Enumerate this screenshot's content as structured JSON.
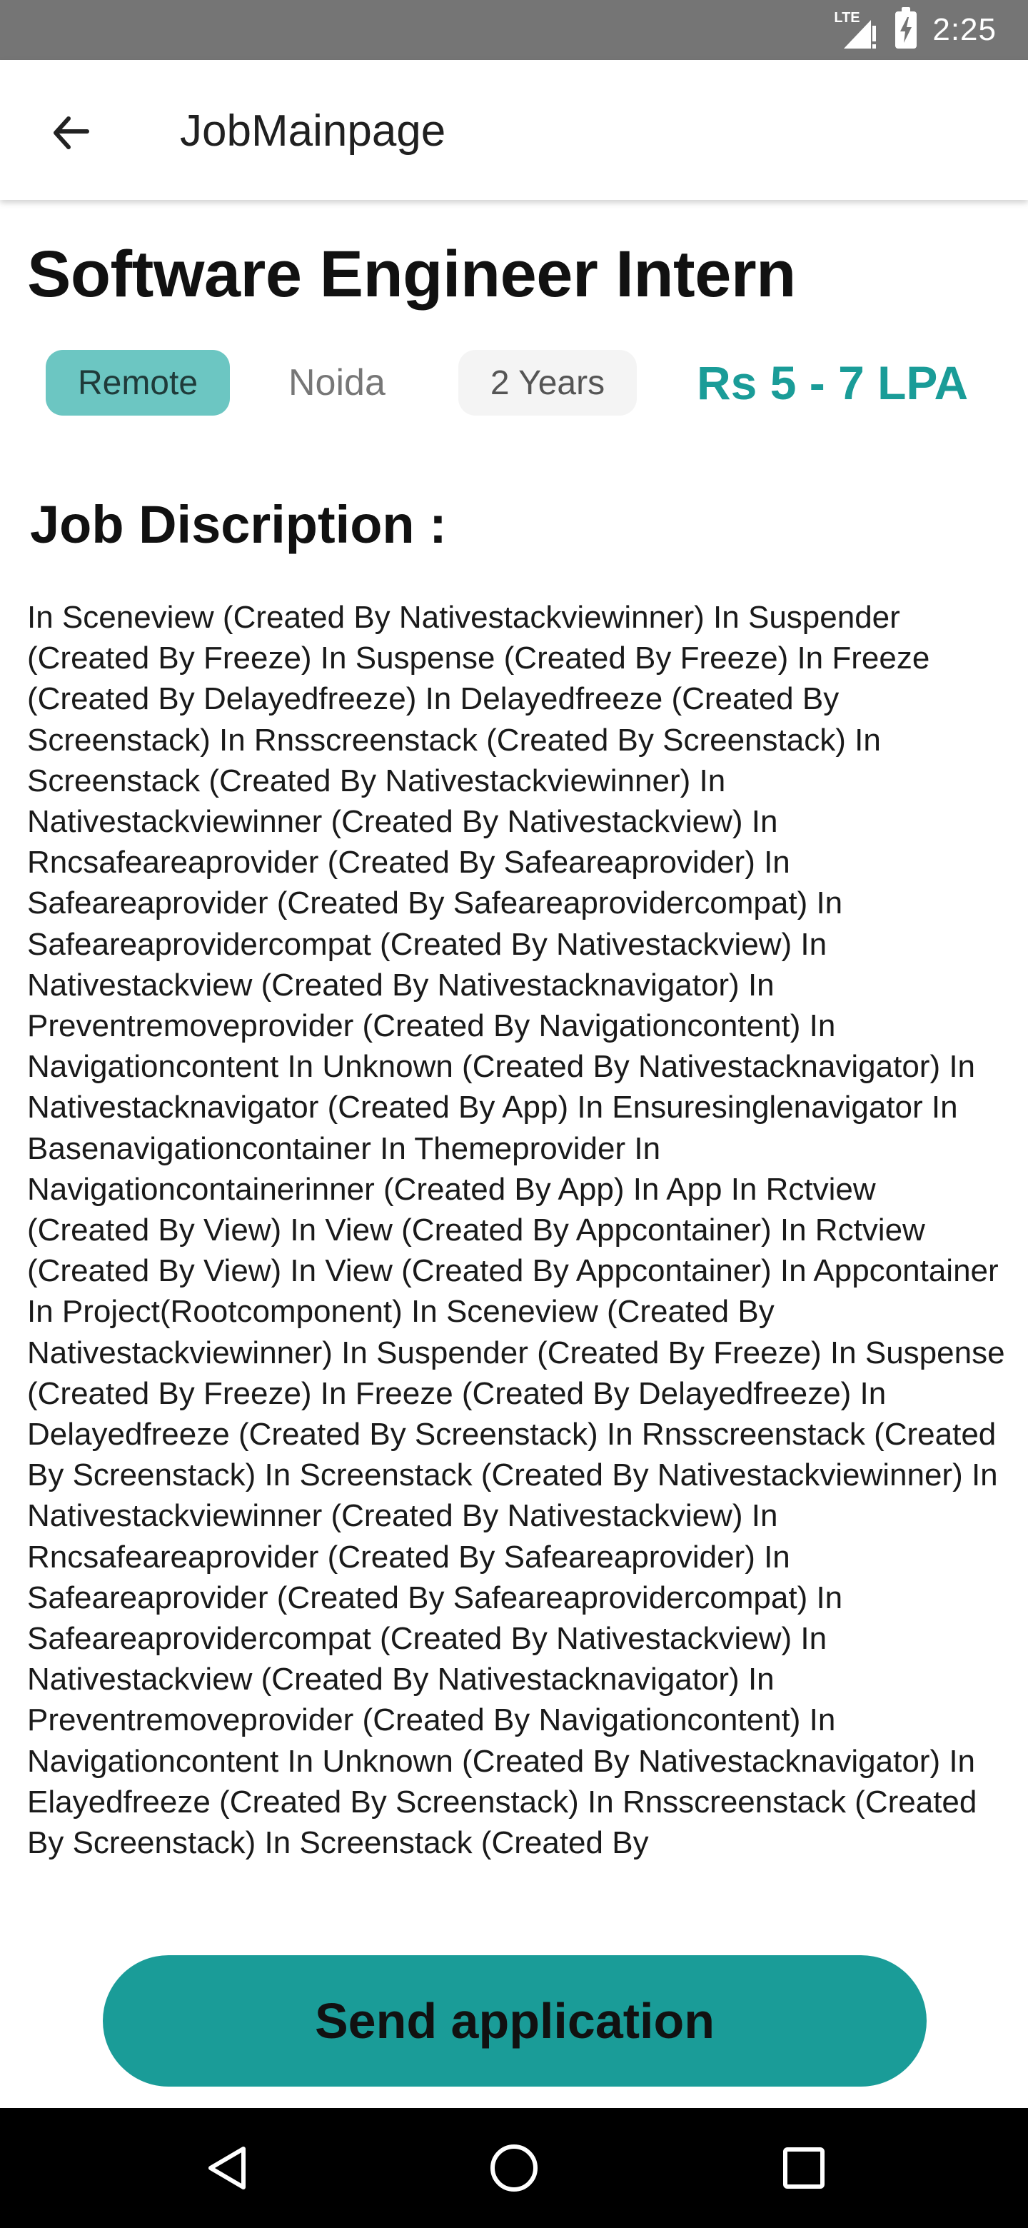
{
  "status_bar": {
    "time": "2:25",
    "network_label": "LTE",
    "icons": [
      "lte-signal-icon",
      "battery-charging-icon"
    ]
  },
  "app_bar": {
    "title": "JobMainpage",
    "back_icon": "arrow-left-icon"
  },
  "job": {
    "title": "Software Engineer Intern",
    "work_mode": "Remote",
    "location": "Noida",
    "experience": "2 Years",
    "salary": "Rs 5 - 7 LPA"
  },
  "description": {
    "heading": "Job Discription :",
    "text": "In Sceneview (Created By Nativestackviewinner) In Suspender (Created By Freeze) In Suspense (Created By Freeze) In Freeze (Created By Delayedfreeze) In Delayedfreeze (Created By Screenstack) In Rnsscreenstack (Created By Screenstack) In Screenstack (Created By Nativestackviewinner) In Nativestackviewinner (Created By Nativestackview) In Rncsafeareaprovider (Created By Safeareaprovider) In Safeareaprovider (Created By Safeareaprovidercompat) In Safeareaprovidercompat (Created By Nativestackview) In Nativestackview (Created By Nativestacknavigator) In Preventremoveprovider (Created By Navigationcontent) In Navigationcontent In Unknown (Created By Nativestacknavigator) In Nativestacknavigator (Created By App) In Ensuresinglenavigator In Basenavigationcontainer In Themeprovider In Navigationcontainerinner (Created By App) In App In Rctview (Created By View) In View (Created By Appcontainer) In Rctview (Created By View) In View (Created By Appcontainer) In Appcontainer In Project(Rootcomponent) In Sceneview (Created By Nativestackviewinner) In Suspender (Created By Freeze) In Suspense (Created By Freeze) In Freeze (Created By Delayedfreeze) In Delayedfreeze (Created By Screenstack) In Rnsscreenstack (Created By Screenstack) In Screenstack (Created By Nativestackviewinner) In Nativestackviewinner (Created By Nativestackview) In Rncsafeareaprovider (Created By Safeareaprovider) In Safeareaprovider (Created By Safeareaprovidercompat) In Safeareaprovidercompat (Created By Nativestackview) In Nativestackview (Created By Nativestacknavigator) In Preventremoveprovider (Created By Navigationcontent) In Navigationcontent In Unknown (Created By Nativestacknavigator) In Elayedfreeze (Created By Screenstack) In Rnsscreenstack (Created By Screenstack) In Screenstack (Created By"
  },
  "actions": {
    "send_label": "Send application"
  },
  "nav_bar": {
    "icons": [
      "nav-back-icon",
      "nav-home-icon",
      "nav-recents-icon"
    ]
  },
  "colors": {
    "accent": "#1a9c98",
    "tag_remote_bg": "#6cc6c2",
    "status_bar": "#757575",
    "nav_bar": "#000000"
  }
}
